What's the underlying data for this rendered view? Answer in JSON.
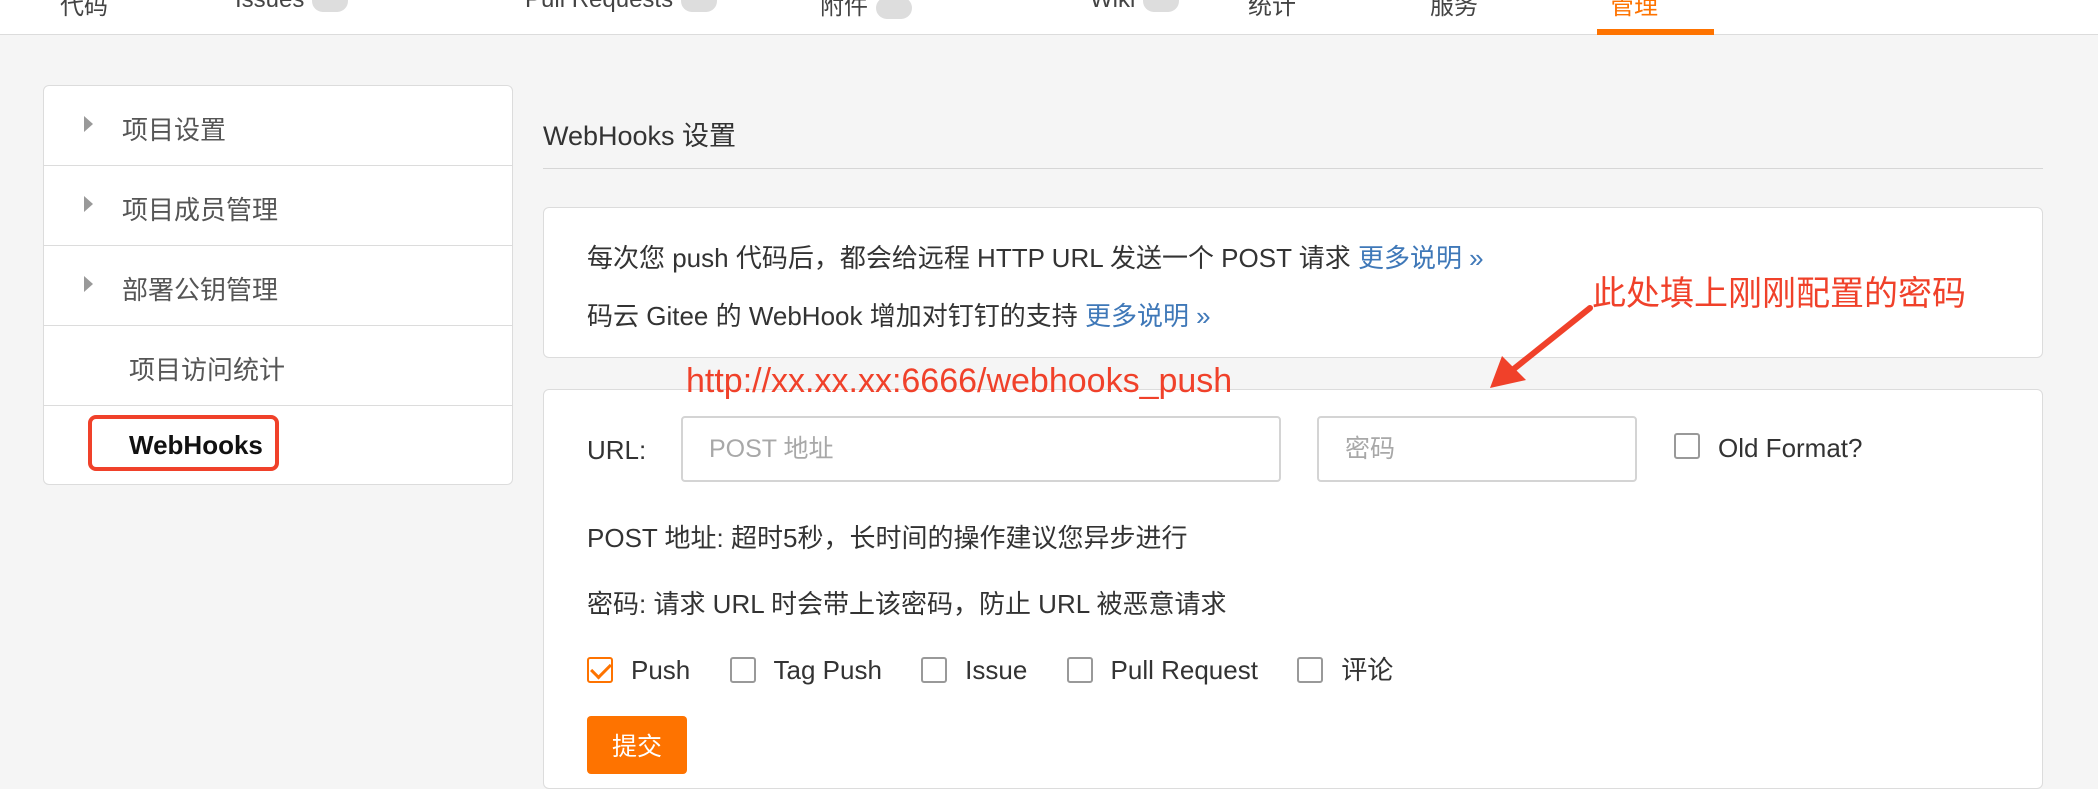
{
  "topnav": {
    "tabs": [
      {
        "label": "代码"
      },
      {
        "label": "Issues"
      },
      {
        "label": "Pull Requests"
      },
      {
        "label": "附件"
      },
      {
        "label": "Wiki"
      },
      {
        "label": "统计"
      },
      {
        "label": "服务"
      },
      {
        "label": "管理"
      }
    ]
  },
  "sidebar": {
    "items": [
      {
        "label": "项目设置"
      },
      {
        "label": "项目成员管理"
      },
      {
        "label": "部署公钥管理"
      },
      {
        "label": "项目访问统计"
      },
      {
        "label": "WebHooks"
      }
    ]
  },
  "main": {
    "title": "WebHooks 设置",
    "info_line1": "每次您 push 代码后，都会给远程 HTTP URL 发送一个 POST 请求 ",
    "info_line2": "码云 Gitee 的 WebHook 增加对钉钉的支持 ",
    "more_link": "更多说明 »",
    "url_label": "URL:",
    "url_placeholder": "POST 地址",
    "password_placeholder": "密码",
    "old_format_label": "Old Format?",
    "help_post": "POST 地址: 超时5秒，长时间的操作建议您异步进行",
    "help_password": "密码: 请求 URL 时会带上该密码，防止 URL 被恶意请求",
    "events": [
      {
        "label": "Push",
        "checked": true
      },
      {
        "label": "Tag Push",
        "checked": false
      },
      {
        "label": "Issue",
        "checked": false
      },
      {
        "label": "Pull Request",
        "checked": false
      },
      {
        "label": "评论",
        "checked": false
      }
    ],
    "submit_label": "提交"
  },
  "annotations": {
    "url_note": "http://xx.xx.xx:6666/webhooks_push",
    "password_note": "此处填上刚刚配置的密码",
    "color": "#f0412a"
  },
  "colors": {
    "accent": "#fe7300",
    "link": "#3f78b8"
  }
}
